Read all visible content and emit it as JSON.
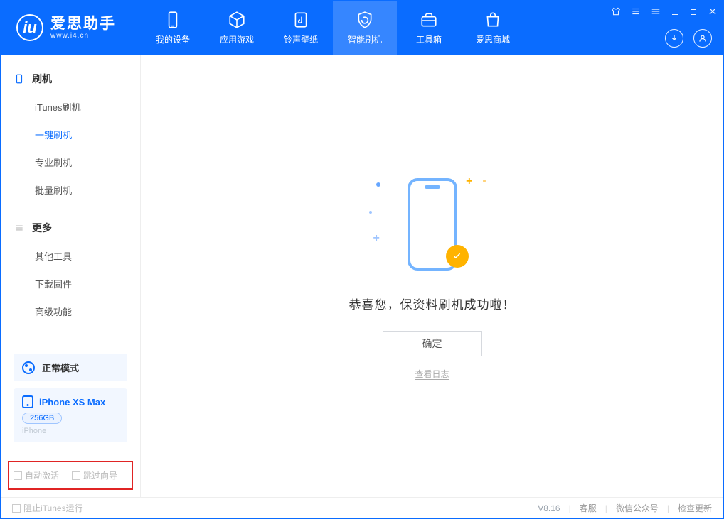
{
  "brand": {
    "title": "爱思助手",
    "subtitle": "www.i4.cn"
  },
  "nav": {
    "tabs": [
      {
        "label": "我的设备"
      },
      {
        "label": "应用游戏"
      },
      {
        "label": "铃声壁纸"
      },
      {
        "label": "智能刷机"
      },
      {
        "label": "工具箱"
      },
      {
        "label": "爱思商城"
      }
    ]
  },
  "sidebar": {
    "group_flash": "刷机",
    "items_flash": [
      "iTunes刷机",
      "一键刷机",
      "专业刷机",
      "批量刷机"
    ],
    "group_more": "更多",
    "items_more": [
      "其他工具",
      "下载固件",
      "高级功能"
    ],
    "mode": "正常模式",
    "device": {
      "name": "iPhone XS Max",
      "storage": "256GB",
      "type": "iPhone"
    },
    "cb_activate": "自动激活",
    "cb_skip": "跳过向导"
  },
  "main": {
    "success_msg": "恭喜您，保资料刷机成功啦！",
    "ok": "确定",
    "view_log": "查看日志"
  },
  "footer": {
    "block_itunes": "阻止iTunes运行",
    "version": "V8.16",
    "support": "客服",
    "wechat": "微信公众号",
    "update": "检查更新"
  }
}
